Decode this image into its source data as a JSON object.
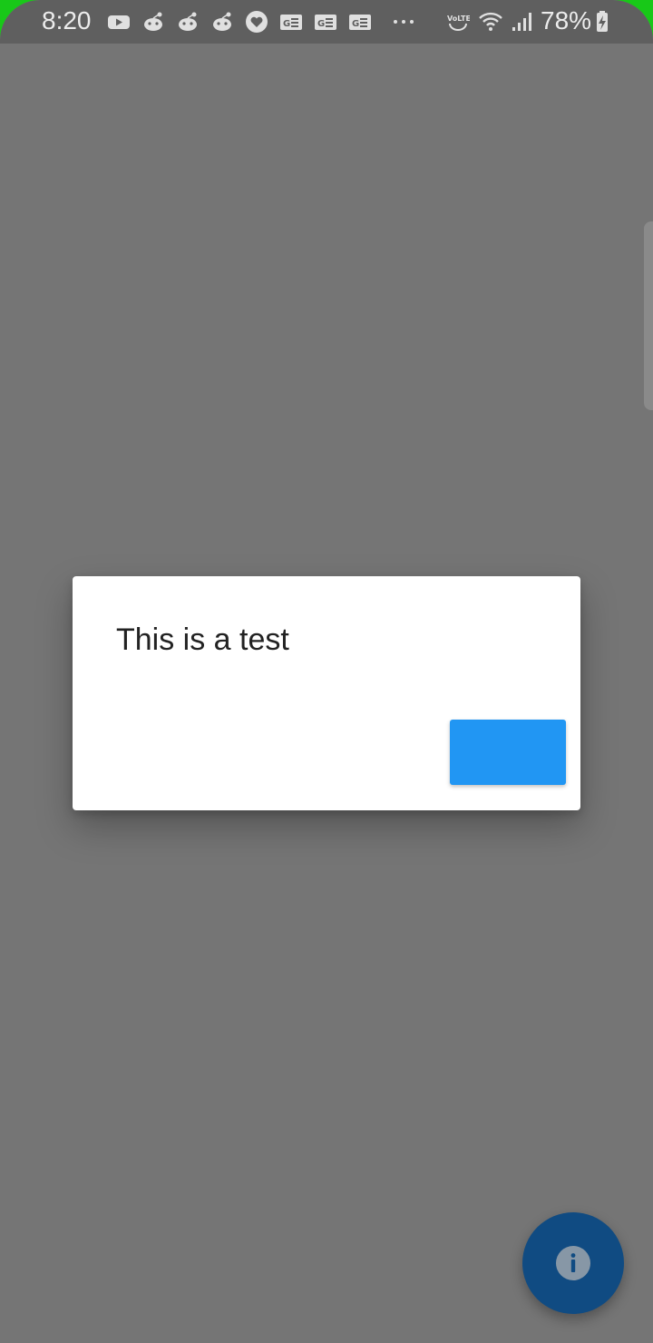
{
  "status_bar": {
    "time": "8:20",
    "battery_percent": "78%",
    "notification_icons": [
      "youtube-icon",
      "reddit-icon",
      "reddit-icon",
      "reddit-icon",
      "app-heart-icon",
      "news-icon",
      "news-icon",
      "news-icon",
      "more-dots-icon"
    ],
    "system_icons": [
      "volte-icon",
      "wifi-icon",
      "signal-icon",
      "battery-charging-icon"
    ]
  },
  "dialog": {
    "title": "This is a test",
    "action_button_label": ""
  },
  "fab": {
    "icon": "info-icon"
  },
  "colors": {
    "scrim": "#757575",
    "dialog_button": "#2196f3",
    "fab": "#104b82",
    "status_accent": "#18c818"
  }
}
